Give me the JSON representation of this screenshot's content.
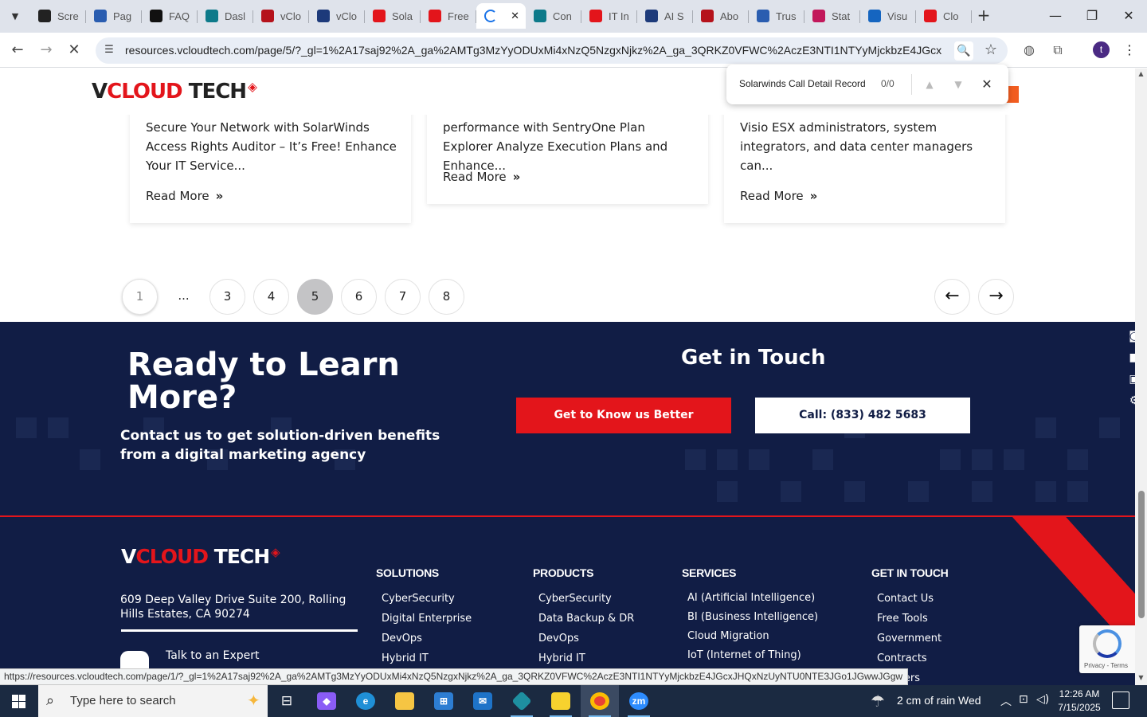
{
  "browser": {
    "tabs": [
      {
        "title": "Scre",
        "icon": "github-icon",
        "color": "#222222"
      },
      {
        "title": "Pag",
        "icon": "speed-icon",
        "color": "#2a5db0"
      },
      {
        "title": "FAQ",
        "icon": "faq-icon",
        "color": "#111111"
      },
      {
        "title": "Dasl",
        "icon": "dashboard-icon",
        "color": "#0d7a8a"
      },
      {
        "title": "vClo",
        "icon": "vcloud-icon",
        "color": "#b5121b"
      },
      {
        "title": "vClo",
        "icon": "vcloud-icon",
        "color": "#1d3a7a"
      },
      {
        "title": "Sola",
        "icon": "solarwinds-icon",
        "color": "#e3151b"
      },
      {
        "title": "Free",
        "icon": "solarwinds-icon",
        "color": "#e3151b"
      },
      {
        "title": "",
        "icon": "loading-icon",
        "active": true
      },
      {
        "title": "Con",
        "icon": "confluence-icon",
        "color": "#0d7a8a"
      },
      {
        "title": "IT In",
        "icon": "solarwinds-icon",
        "color": "#e3151b"
      },
      {
        "title": "AI S",
        "icon": "x-icon",
        "color": "#1d3a7a"
      },
      {
        "title": "Abo",
        "icon": "about-icon",
        "color": "#b5121b"
      },
      {
        "title": "Trus",
        "icon": "trust-icon",
        "color": "#2a5db0"
      },
      {
        "title": "Stat",
        "icon": "status-icon",
        "color": "#c2185b"
      },
      {
        "title": "Visu",
        "icon": "visual-icon",
        "color": "#1565c0"
      },
      {
        "title": "Clo",
        "icon": "cloud-icon",
        "color": "#e3151b"
      }
    ],
    "url": "resources.vcloudtech.com/page/5/?_gl=1%2A17saj92%2A_ga%2AMTg3MzYyODUxMi4xNzQ5NzgxNjkz%2A_ga_3QRKZ0VFWC%2AczE3NTI1NTYyMjckbzE4JGcxJHQx...",
    "profile_initial": "t",
    "status_url": "https://resources.vcloudtech.com/page/1/?_gl=1%2A17saj92%2A_ga%2AMTg3MzYyODUxMi4xNzQ5NzgxNjkz%2A_ga_3QRKZ0VFWC%2AczE3NTI1NTYyMjckbzE4JGcxJHQxNzUyNTU0NTE3JGo1JGwwJGgw",
    "find_bar": {
      "query": "Solarwinds Call Detail Record",
      "count": "0/0"
    }
  },
  "site": {
    "logo": {
      "v": "V",
      "cloud": "CLOUD",
      "tech": " TECH",
      "mark": "◈"
    },
    "cards": [
      {
        "excerpt": "Secure Your Network with SolarWinds Access Rights Auditor – It’s Free! Enhance Your IT Service...",
        "read_more": "Read More"
      },
      {
        "excerpt": "performance with SentryOne Plan Explorer Analyze Execution Plans and Enhance...",
        "read_more": "Read More"
      },
      {
        "excerpt": "Visio ESX administrators, system integrators, and data center managers can...",
        "read_more": "Read More"
      }
    ],
    "pagination": [
      "1",
      "...",
      "3",
      "4",
      "5",
      "6",
      "7",
      "8"
    ],
    "current_page": "5",
    "cta": {
      "title": "Ready to Learn More?",
      "subtitle": "Contact us to get solution-driven benefits from a digital marketing agency",
      "get_in_touch": "Get in Touch",
      "know_button": "Get to Know us Better",
      "call_button": "Call: (833) 482 5683"
    },
    "footer": {
      "address": "609 Deep Valley Drive Suite 200, Rolling Hills Estates, CA 90274",
      "expert": "Talk to an Expert",
      "columns": [
        {
          "title": "SOLUTIONS",
          "items": [
            "CyberSecurity",
            "Digital Enterprise",
            "DevOps",
            "Hybrid IT"
          ]
        },
        {
          "title": "PRODUCTS",
          "items": [
            "CyberSecurity",
            "Data Backup & DR",
            "DevOps",
            "Hybrid IT"
          ]
        },
        {
          "title": "SERVICES",
          "items": [
            "AI (Artificial Intelligence)",
            "BI (Business Intelligence)",
            "Cloud Migration",
            "IoT (Internet of Thing)"
          ]
        },
        {
          "title": "GET IN TOUCH",
          "items": [
            "Contact Us",
            "Free Tools",
            "Government",
            "Contracts",
            "Partners"
          ]
        }
      ],
      "recaptcha_terms": "Privacy - Terms"
    }
  },
  "taskbar": {
    "search_placeholder": "Type here to search",
    "weather": "2 cm of rain Wed",
    "time": "12:26 AM",
    "date": "7/15/2025"
  }
}
